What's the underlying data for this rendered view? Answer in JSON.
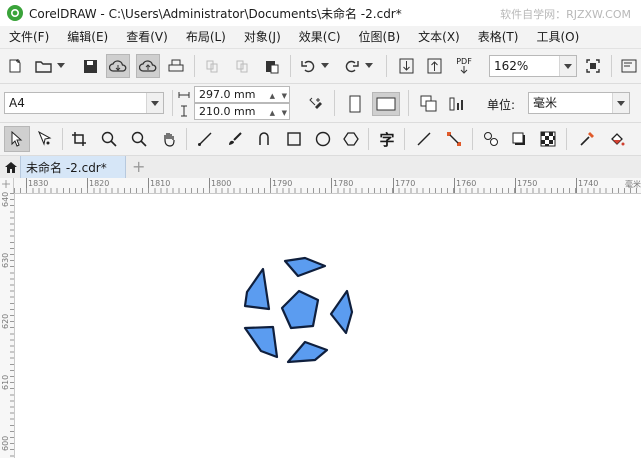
{
  "window": {
    "title": "CorelDRAW - C:\\Users\\Administrator\\Documents\\未命名 -2.cdr*",
    "watermark": "软件自学网：RJZXW.COM"
  },
  "menu": [
    "文件(F)",
    "编辑(E)",
    "查看(V)",
    "布局(L)",
    "对象(J)",
    "效果(C)",
    "位图(B)",
    "文本(X)",
    "表格(T)",
    "工具(O)"
  ],
  "toolbar": {
    "zoom_value": "162%",
    "pdf_label": "PDF"
  },
  "property_bar": {
    "page_size": "A4",
    "width": "297.0 mm",
    "height": "210.0 mm",
    "units_label": "单位:",
    "units_value": "毫米"
  },
  "toolbox": {
    "text_tool_glyph": "字"
  },
  "document_tab": {
    "label": "未命名 -2.cdr*",
    "add_symbol": "+"
  },
  "ruler": {
    "h_ticks": [
      "1830",
      "1820",
      "1810",
      "1800",
      "1790",
      "1780",
      "1770",
      "1760",
      "1750",
      "1740"
    ],
    "h_unit": "毫米",
    "v_ticks": [
      "640",
      "630",
      "620",
      "610",
      "600"
    ]
  },
  "colors": {
    "shape_fill": "#5b9cf0",
    "shape_stroke": "#0f1f3d",
    "app_green": "#3aa33a",
    "tab_active": "#d6e6f7"
  }
}
